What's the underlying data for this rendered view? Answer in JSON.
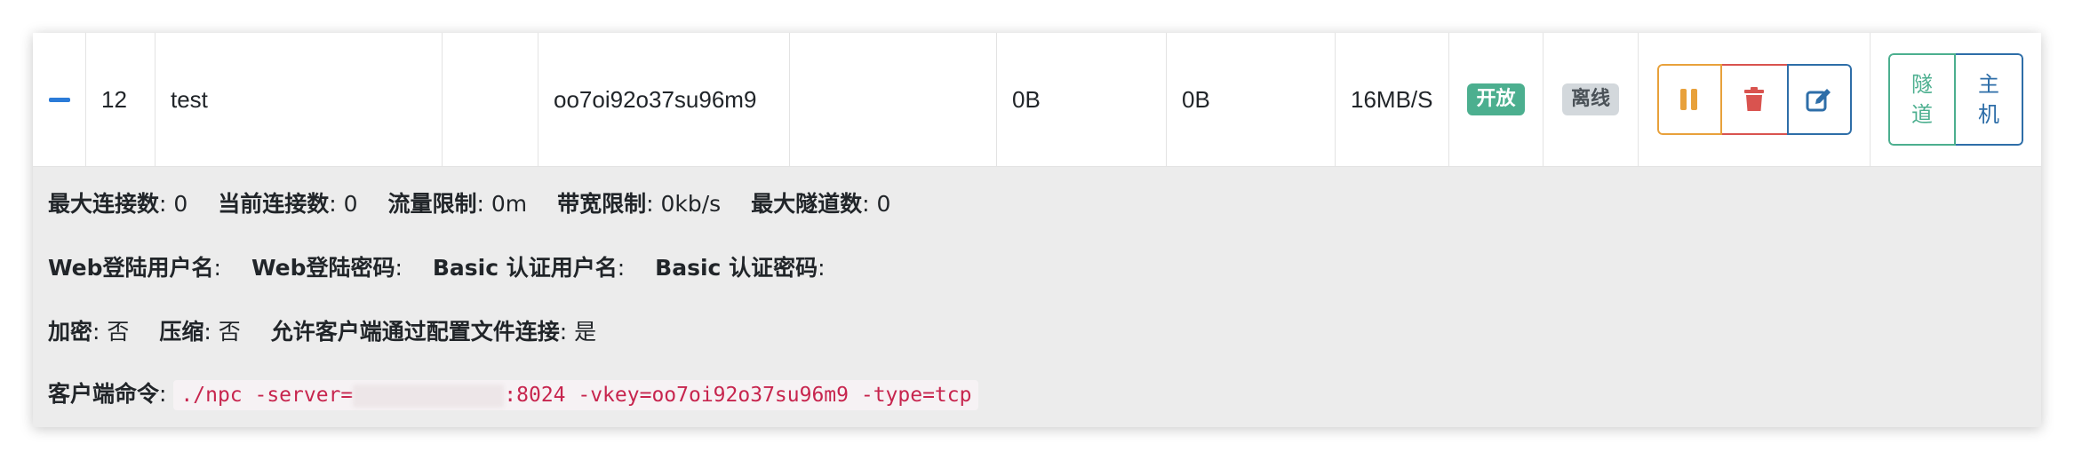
{
  "row": {
    "id": "12",
    "remark": "test",
    "username": "",
    "vkey": "oo7oi92o37su96m9",
    "address": "",
    "inflow": "0B",
    "outflow": "0B",
    "rate": "16MB/S",
    "status_badge": "开放",
    "connection_badge": "离线"
  },
  "actions": {
    "pause_icon": "pause-icon",
    "delete_icon": "trash-icon",
    "edit_icon": "edit-icon",
    "tunnel_label_1": "隧",
    "tunnel_label_2": "道",
    "host_label_1": "主",
    "host_label_2": "机"
  },
  "details": {
    "max_conn_label": "最大连接数",
    "max_conn_value": ": 0",
    "cur_conn_label": "当前连接数",
    "cur_conn_value": ": 0",
    "flow_limit_label": "流量限制",
    "flow_limit_value": ": 0m",
    "bw_limit_label": "带宽限制",
    "bw_limit_value": ": 0kb/s",
    "max_tunnel_label": "最大隧道数",
    "max_tunnel_value": ": 0",
    "web_user_label": "Web登陆用户名",
    "web_user_value": ":",
    "web_pass_label": "Web登陆密码",
    "web_pass_value": ":",
    "basic_user_label": "Basic 认证用户名",
    "basic_user_value": ":",
    "basic_pass_label": "Basic 认证密码",
    "basic_pass_value": ":",
    "encrypt_label": "加密",
    "encrypt_value": ": 否",
    "compress_label": "压缩",
    "compress_value": ": 否",
    "config_conn_label": "允许客户端通过配置文件连接",
    "config_conn_value": ": 是",
    "cmd_label": "客户端命令",
    "cmd_colon": ":",
    "cmd_prefix": "./npc -server=",
    "cmd_suffix": ":8024 -vkey=oo7oi92o37su96m9 -type=tcp"
  },
  "colors": {
    "accent": "#2b7bd8",
    "open": "#4caf8f",
    "warning": "#e8a13b",
    "danger": "#d9534f",
    "primary": "#2e6ea8",
    "code": "#c7254e"
  }
}
